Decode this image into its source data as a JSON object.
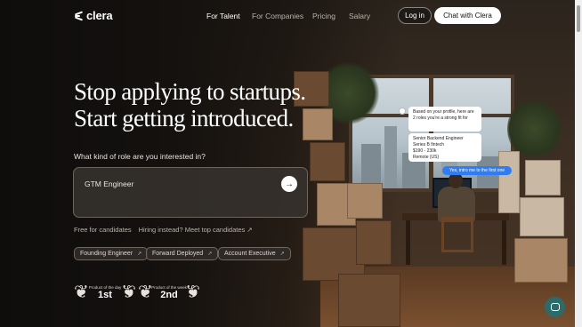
{
  "brand": {
    "name": "clera"
  },
  "nav": {
    "links": [
      "For Talent",
      "For Companies",
      "Pricing",
      "Salary"
    ],
    "login_label": "Log in",
    "chat_label": "Chat with Clera"
  },
  "hero": {
    "headline_line1": "Stop applying to startups.",
    "headline_line2": "Start getting introduced.",
    "question": "What kind of role are you interested in?",
    "input_value": "GTM Engineer",
    "submit_icon": "arrow-right-icon",
    "free_label": "Free for candidates",
    "hiring_label": "Hiring instead? Meet top candidates ↗",
    "chips": [
      "Founding Engineer",
      "Forward Deployed",
      "Account Executive"
    ],
    "awards": [
      {
        "label": "Product of the day",
        "rank": "1st"
      },
      {
        "label": "Product of the week",
        "rank": "2nd"
      }
    ]
  },
  "chat_preview": {
    "message": "Based on your profile, here are 2 roles you're a strong fit for",
    "job_title": "Senior Backend Engineer",
    "job_company": "Series B fintech",
    "job_salary": "$190 - 230k",
    "job_location": "Remote (US)",
    "reply": "Yes, intro me to the first one"
  },
  "colors": {
    "accent_blue": "#2f7cf5",
    "help_button": "#2d6b6b"
  }
}
